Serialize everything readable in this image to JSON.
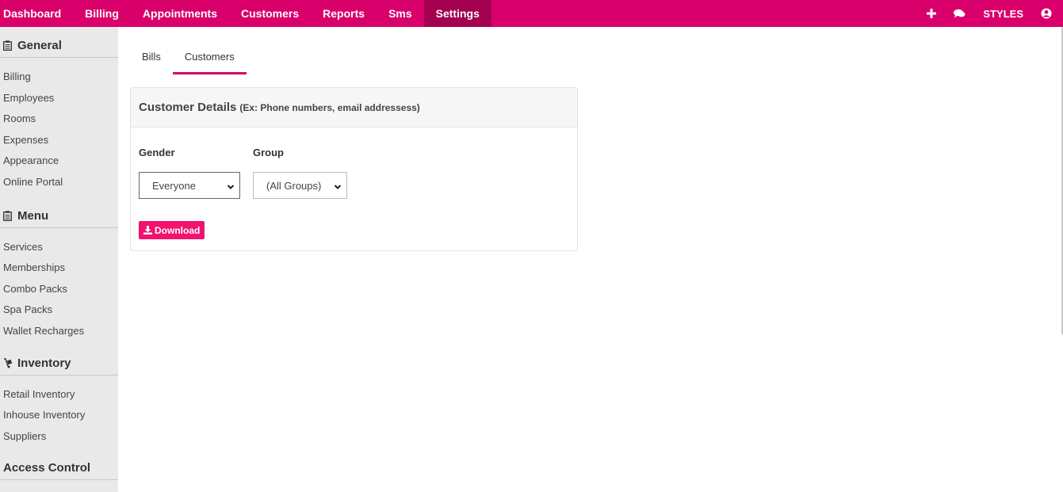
{
  "navbar": {
    "items": [
      "Dashboard",
      "Billing",
      "Appointments",
      "Customers",
      "Reports",
      "Sms",
      "Settings"
    ],
    "active": "Settings",
    "right": {
      "add_icon": "plus-icon",
      "chat_icon": "comments-icon",
      "styles_label": "STYLES",
      "user_icon": "user-circle-icon"
    }
  },
  "sidebar": {
    "general": {
      "title": "General",
      "icon": "clipboard-icon",
      "items": [
        "Billing",
        "Employees",
        "Rooms",
        "Expenses",
        "Appearance",
        "Online Portal"
      ]
    },
    "menu": {
      "title": "Menu",
      "icon": "clipboard-icon",
      "items": [
        "Services",
        "Memberships",
        "Combo Packs",
        "Spa Packs",
        "Wallet Recharges"
      ]
    },
    "inventory": {
      "title": "Inventory",
      "icon": "dolly-icon",
      "items": [
        "Retail Inventory",
        "Inhouse Inventory",
        "Suppliers"
      ]
    },
    "access": {
      "title": "Access Control"
    }
  },
  "tabs": {
    "bills": "Bills",
    "customers": "Customers",
    "active": "Customers"
  },
  "panel": {
    "title": "Customer Details",
    "subtitle": "(Ex: Phone numbers, email addressess)",
    "gender_label": "Gender",
    "gender_value": "Everyone",
    "group_label": "Group",
    "group_value": "(All Groups)",
    "download_label": "Download"
  },
  "colors": {
    "brand": "#d9006c",
    "brand_active": "#a3004f",
    "button": "#f0136f"
  }
}
